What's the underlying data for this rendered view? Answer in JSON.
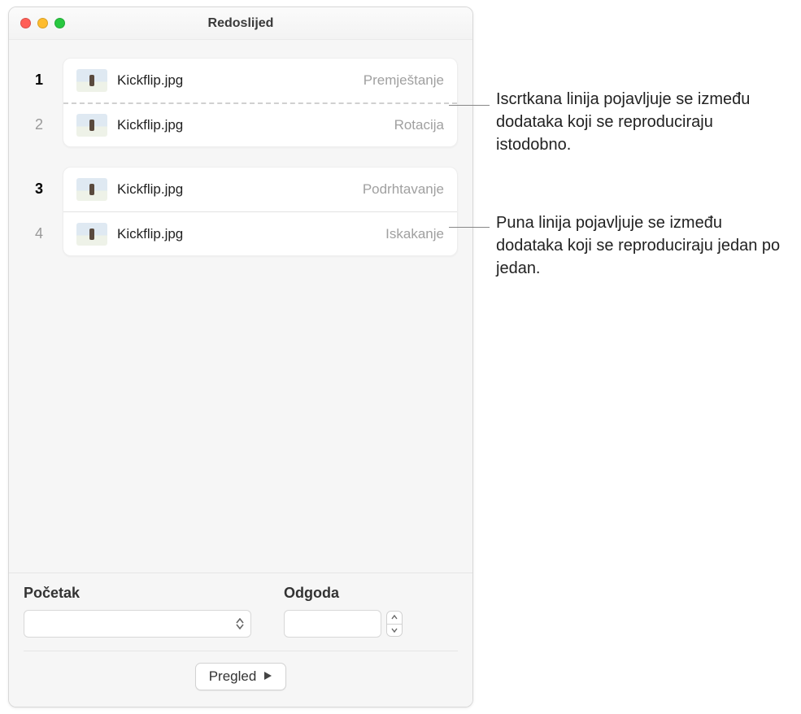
{
  "window": {
    "title": "Redoslijed"
  },
  "groups": [
    {
      "separator": "dashed",
      "rows": [
        {
          "index": "1",
          "active": true,
          "filename": "Kickflip.jpg",
          "effect": "Premještanje"
        },
        {
          "index": "2",
          "active": false,
          "filename": "Kickflip.jpg",
          "effect": "Rotacija"
        }
      ]
    },
    {
      "separator": "solid",
      "rows": [
        {
          "index": "3",
          "active": true,
          "filename": "Kickflip.jpg",
          "effect": "Podrhtavanje"
        },
        {
          "index": "4",
          "active": false,
          "filename": "Kickflip.jpg",
          "effect": "Iskakanje"
        }
      ]
    }
  ],
  "controls": {
    "start_label": "Početak",
    "delay_label": "Odgoda",
    "start_value": "",
    "delay_value": ""
  },
  "preview_label": "Pregled",
  "callouts": {
    "dashed": "Iscrtkana linija pojavljuje se između dodataka koji se reproduciraju istodobno.",
    "solid": "Puna linija pojavljuje se između dodataka koji se reproduciraju jedan po jedan."
  }
}
